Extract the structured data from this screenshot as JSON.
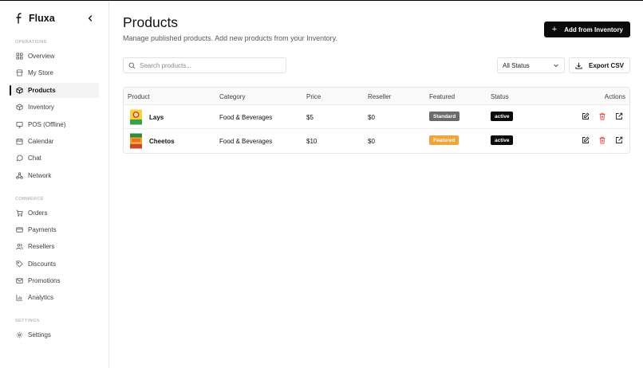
{
  "app": {
    "name": "Fluxa"
  },
  "sidebar": {
    "sections": [
      {
        "label": "OPERATIONS",
        "items": [
          {
            "label": "Overview",
            "icon": "grid-icon"
          },
          {
            "label": "My Store",
            "icon": "store-icon"
          },
          {
            "label": "Products",
            "icon": "box-icon",
            "active": true
          },
          {
            "label": "Inventory",
            "icon": "package-icon"
          },
          {
            "label": "POS (Offline)",
            "icon": "monitor-icon"
          },
          {
            "label": "Calendar",
            "icon": "calendar-icon"
          },
          {
            "label": "Chat",
            "icon": "chat-icon"
          },
          {
            "label": "Network",
            "icon": "network-icon"
          }
        ]
      },
      {
        "label": "COMMERCE",
        "items": [
          {
            "label": "Orders",
            "icon": "cart-icon"
          },
          {
            "label": "Payments",
            "icon": "card-icon"
          },
          {
            "label": "Resellers",
            "icon": "users-icon"
          },
          {
            "label": "Discounts",
            "icon": "tag-icon"
          },
          {
            "label": "Promotions",
            "icon": "mail-icon"
          },
          {
            "label": "Analytics",
            "icon": "chart-icon"
          }
        ]
      },
      {
        "label": "SETTINGS",
        "items": [
          {
            "label": "Settings",
            "icon": "gear-icon"
          }
        ]
      }
    ]
  },
  "header": {
    "title": "Products",
    "subtitle": "Manage published products. Add new products from your Inventory.",
    "add_button": "Add from Inventory"
  },
  "toolbar": {
    "search_placeholder": "Search products...",
    "status_filter": "All Status",
    "export_button": "Export CSV"
  },
  "table": {
    "columns": [
      "Product",
      "Category",
      "Price",
      "Reseller",
      "Featured",
      "Status",
      "Actions"
    ],
    "rows": [
      {
        "product": "Lays",
        "category": "Food & Beverages",
        "price": "$5",
        "reseller": "$0",
        "featured": "Standard",
        "status": "active"
      },
      {
        "product": "Cheetos",
        "category": "Food & Beverages",
        "price": "$10",
        "reseller": "$0",
        "featured": "Featured",
        "status": "active"
      }
    ]
  },
  "colors": {
    "primary": "#0b0b0b",
    "badge_standard": "#6b6b6b",
    "badge_featured": "#f0a43a",
    "badge_active": "#0b0b0b",
    "delete": "#e05252"
  }
}
